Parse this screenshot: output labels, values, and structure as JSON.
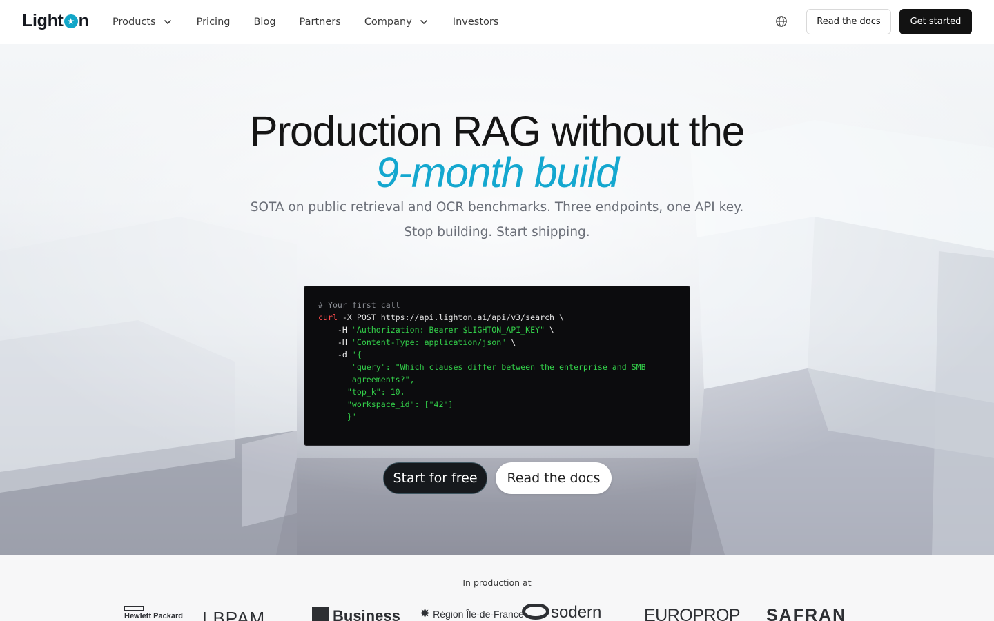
{
  "nav": {
    "logo": "LightOn",
    "items": [
      {
        "label": "Products",
        "has_dropdown": true
      },
      {
        "label": "Pricing",
        "has_dropdown": false
      },
      {
        "label": "Blog",
        "has_dropdown": false
      },
      {
        "label": "Partners",
        "has_dropdown": false
      },
      {
        "label": "Company",
        "has_dropdown": true
      },
      {
        "label": "Investors",
        "has_dropdown": false
      }
    ],
    "language_icon": "globe-icon",
    "read_docs": "Read the docs",
    "get_started": "Get started"
  },
  "hero": {
    "headline_line1": "Production RAG without the",
    "headline_line2": "9-month build",
    "subtitle_line1": "SOTA on public retrieval and OCR benchmarks. Three endpoints, one API key.",
    "subtitle_line2": "Stop building. Start shipping.",
    "accent_color": "#14a7cf",
    "code": {
      "comment": "# Your first call",
      "cmd": "curl",
      "line1_rest": " -X POST https://api.lighton.ai/api/v3/search \\",
      "h1_flag": "    -H ",
      "h1_value": "\"Authorization: Bearer $LIGHTON_API_KEY\"",
      "h1_end": " \\",
      "h2_flag": "    -H ",
      "h2_value": "\"Content-Type: application/json\"",
      "h2_end": " \\",
      "d_flag": "    -d ",
      "d_open": "'{",
      "query_line1": "       \"query\": \"Which clauses differ between the enterprise and SMB",
      "query_line2": "       agreements?\",",
      "topk": "      \"top_k\": 10,",
      "workspace": "      \"workspace_id\": [\"42\"]",
      "close": "      }'"
    },
    "cta_primary": "Start for free",
    "cta_secondary": "Read the docs"
  },
  "production": {
    "label": "In production at",
    "logos": [
      "Hewlett Packard",
      "LBPAM",
      "Business",
      "Région Île-de-France",
      "sodern",
      "EUROPROP",
      "SAFRAN"
    ]
  }
}
